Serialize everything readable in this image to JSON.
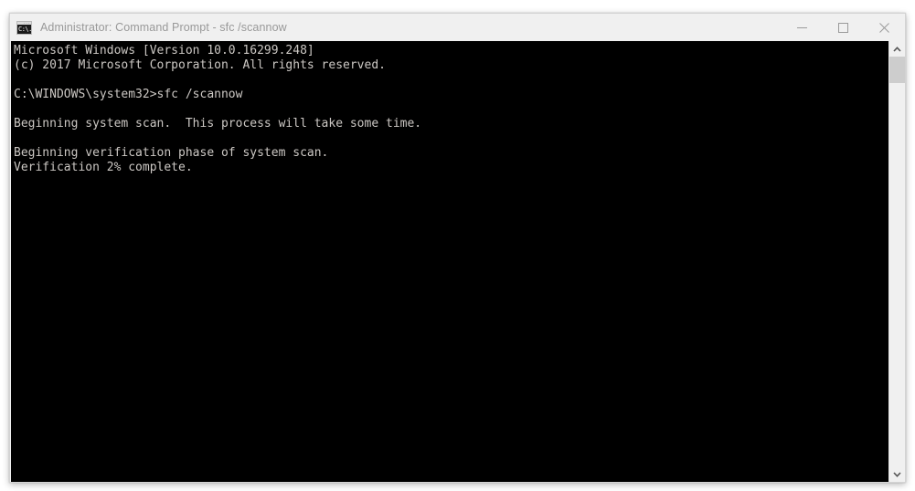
{
  "window": {
    "title": "Administrator: Command Prompt - sfc  /scannow",
    "icon": "command-prompt-icon",
    "icon_glyph": "C:\\.",
    "state": "restored",
    "controls": {
      "minimize_label": "Minimize",
      "maximize_label": "Maximize",
      "close_label": "Close"
    }
  },
  "terminal": {
    "background_color": "#000000",
    "text_color": "#ccc8c4",
    "lines": [
      "Microsoft Windows [Version 10.0.16299.248]",
      "(c) 2017 Microsoft Corporation. All rights reserved.",
      "",
      "C:\\WINDOWS\\system32>sfc /scannow",
      "",
      "Beginning system scan.  This process will take some time.",
      "",
      "Beginning verification phase of system scan.",
      "Verification 2% complete."
    ],
    "os_name": "Microsoft Windows",
    "os_version": "10.0.16299.248",
    "copyright": "(c) 2017 Microsoft Corporation. All rights reserved.",
    "prompt_path": "C:\\WINDOWS\\system32>",
    "command": "sfc /scannow",
    "progress_percent": "2%",
    "status_message": "Verification 2% complete."
  },
  "scrollbar": {
    "up_arrow": "chevron-up-icon",
    "down_arrow": "chevron-down-icon",
    "thumb_color": "#cdcdcd",
    "track_color": "#f0f0f0"
  }
}
